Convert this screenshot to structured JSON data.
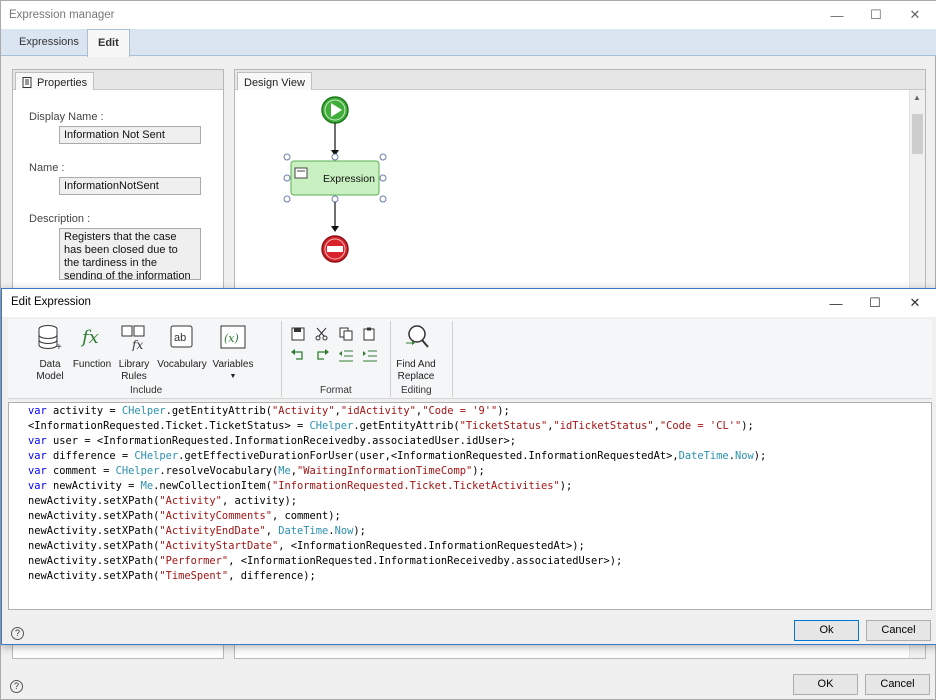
{
  "outer_window": {
    "title": "Expression manager",
    "tabs": [
      {
        "label": "Expressions"
      },
      {
        "label": "Edit"
      }
    ],
    "ok_label": "OK",
    "cancel_label": "Cancel"
  },
  "properties_panel": {
    "tab_label": "Properties",
    "display_name_label": "Display Name :",
    "display_name_value": "Information Not Sent",
    "name_label": "Name :",
    "name_value": "InformationNotSent",
    "description_label": "Description :",
    "description_value": "Registers that the case has been closed due to the tardiness in the sending of the information"
  },
  "design_view": {
    "tab_label": "Design View",
    "node_label": "Expression"
  },
  "dialog": {
    "title": "Edit Expression",
    "ribbon": {
      "include_group": "Include",
      "format_group": "Format",
      "editing_group": "Editing",
      "data_model": "Data\nModel",
      "function": "Function",
      "library_rules": "Library\nRules",
      "vocabulary": "Vocabulary",
      "variables": "Variables",
      "find_replace": "Find And\nReplace"
    },
    "ok_label": "Ok",
    "cancel_label": "Cancel"
  },
  "code_lines": [
    [
      [
        "k",
        "var"
      ],
      [
        "t",
        " activity = "
      ],
      [
        "c",
        "CHelper"
      ],
      [
        "t",
        ".getEntityAttrib("
      ],
      [
        "s",
        "\"Activity\""
      ],
      [
        "t",
        ","
      ],
      [
        "s",
        "\"idActivity\""
      ],
      [
        "t",
        ","
      ],
      [
        "s",
        "\"Code = '9'\""
      ],
      [
        "t",
        ");"
      ]
    ],
    [
      [
        "t",
        "<InformationRequested.Ticket.TicketStatus> = "
      ],
      [
        "c",
        "CHelper"
      ],
      [
        "t",
        ".getEntityAttrib("
      ],
      [
        "s",
        "\"TicketStatus\""
      ],
      [
        "t",
        ","
      ],
      [
        "s",
        "\"idTicketStatus\""
      ],
      [
        "t",
        ","
      ],
      [
        "s",
        "\"Code = 'CL'\""
      ],
      [
        "t",
        ");"
      ]
    ],
    [
      [
        "k",
        "var"
      ],
      [
        "t",
        " user = <InformationRequested.InformationReceivedby.associatedUser.idUser>;"
      ]
    ],
    [
      [
        "k",
        "var"
      ],
      [
        "t",
        " difference = "
      ],
      [
        "c",
        "CHelper"
      ],
      [
        "t",
        ".getEffectiveDurationForUser(user,<InformationRequested.InformationRequestedAt>,"
      ],
      [
        "c",
        "DateTime"
      ],
      [
        "t",
        "."
      ],
      [
        "c",
        "Now"
      ],
      [
        "t",
        ");"
      ]
    ],
    [
      [
        "k",
        "var"
      ],
      [
        "t",
        " comment = "
      ],
      [
        "c",
        "CHelper"
      ],
      [
        "t",
        ".resolveVocabulary("
      ],
      [
        "c",
        "Me"
      ],
      [
        "t",
        ","
      ],
      [
        "s",
        "\"WaitingInformationTimeComp\""
      ],
      [
        "t",
        ");"
      ]
    ],
    [
      [
        "k",
        "var"
      ],
      [
        "t",
        " newActivity = "
      ],
      [
        "c",
        "Me"
      ],
      [
        "t",
        ".newCollectionItem("
      ],
      [
        "s",
        "\"InformationRequested.Ticket.TicketActivities\""
      ],
      [
        "t",
        ");"
      ]
    ],
    [
      [
        "t",
        "newActivity.setXPath("
      ],
      [
        "s",
        "\"Activity\""
      ],
      [
        "t",
        ", activity);"
      ]
    ],
    [
      [
        "t",
        "newActivity.setXPath("
      ],
      [
        "s",
        "\"ActivityComments\""
      ],
      [
        "t",
        ", comment);"
      ]
    ],
    [
      [
        "t",
        "newActivity.setXPath("
      ],
      [
        "s",
        "\"ActivityEndDate\""
      ],
      [
        "t",
        ", "
      ],
      [
        "c",
        "DateTime"
      ],
      [
        "t",
        "."
      ],
      [
        "c",
        "Now"
      ],
      [
        "t",
        ");"
      ]
    ],
    [
      [
        "t",
        "newActivity.setXPath("
      ],
      [
        "s",
        "\"ActivityStartDate\""
      ],
      [
        "t",
        ", <InformationRequested.InformationRequestedAt>);"
      ]
    ],
    [
      [
        "t",
        "newActivity.setXPath("
      ],
      [
        "s",
        "\"Performer\""
      ],
      [
        "t",
        ", <InformationRequested.InformationReceivedby.associatedUser>);"
      ]
    ],
    [
      [
        "t",
        "newActivity.setXPath("
      ],
      [
        "s",
        "\"TimeSpent\""
      ],
      [
        "t",
        ", difference);"
      ]
    ]
  ],
  "colors": {
    "keyword": "#0000ff",
    "class": "#2b91af",
    "string": "#a31515",
    "dialog_border": "#3b79c9",
    "start_node": "#3fae3a",
    "end_node": "#d9232b"
  }
}
